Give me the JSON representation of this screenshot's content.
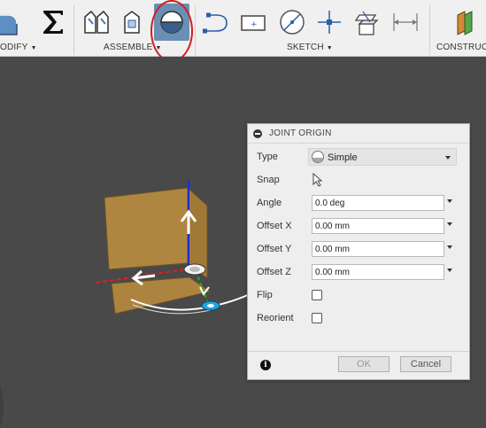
{
  "toolbar": {
    "modify_label": "ODIFY",
    "assemble_label": "ASSEMBLE",
    "sketch_label": "SKETCH",
    "construct_label": "CONSTRUCT",
    "highlight_color": "#d41c1c",
    "active_color": "#6a8fb5"
  },
  "dialog": {
    "title": "JOINT ORIGIN",
    "type": {
      "label": "Type",
      "value": "Simple"
    },
    "snap": {
      "label": "Snap"
    },
    "angle": {
      "label": "Angle",
      "value": "0.0 deg"
    },
    "offset_x": {
      "label": "Offset X",
      "value": "0.00 mm"
    },
    "offset_y": {
      "label": "Offset Y",
      "value": "0.00 mm"
    },
    "offset_z": {
      "label": "Offset Z",
      "value": "0.00 mm"
    },
    "flip": {
      "label": "Flip",
      "checked": false
    },
    "reorient": {
      "label": "Reorient",
      "checked": false
    },
    "ok_label": "OK",
    "cancel_label": "Cancel"
  },
  "viewport": {
    "face_color": "#b58a40",
    "axis_z_color": "#1e2ad8",
    "axis_x_color": "#d82020",
    "axis_y_color": "#19b21e",
    "origin_color": "#19a8e0"
  }
}
